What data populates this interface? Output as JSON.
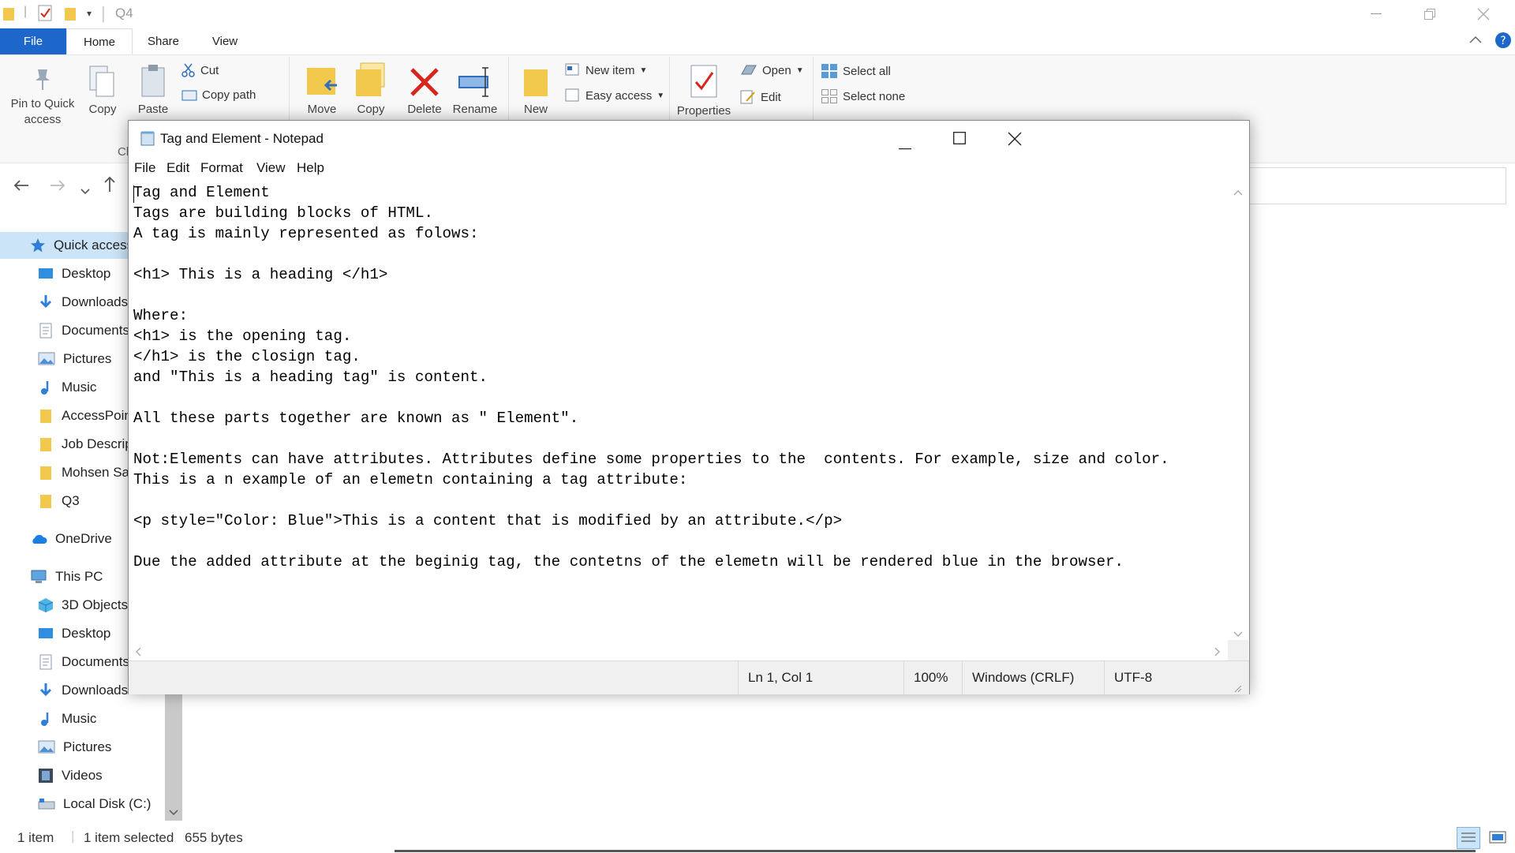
{
  "explorer": {
    "title": "Q4",
    "qat_dropdown": "▾",
    "tabs": [
      "File",
      "Home",
      "Share",
      "View"
    ],
    "ribbon": {
      "pin_to_quick_access": "Pin to Quick access",
      "copy": "Copy",
      "paste": "Paste",
      "cut": "Cut",
      "copy_path": "Copy path",
      "clipboard_partial": "Cl",
      "move": "Move",
      "copy_to": "Copy",
      "delete": "Delete",
      "rename": "Rename",
      "new": "New",
      "new_item": "New item",
      "easy_access": "Easy access",
      "properties": "Properties",
      "open": "Open",
      "edit": "Edit",
      "select_all": "Select all",
      "select_none": "Select none"
    },
    "sidebar": {
      "quick_access": "Quick access",
      "quick_items": [
        "Desktop",
        "Downloads",
        "Documents",
        "Pictures",
        "Music",
        "AccessPoint",
        "Job Description",
        "Mohsen Sa",
        "Q3"
      ],
      "onedrive": "OneDrive",
      "this_pc": "This PC",
      "pc_items": [
        "3D Objects",
        "Desktop",
        "Documents",
        "Downloads",
        "Music",
        "Pictures",
        "Videos",
        "Local Disk (C:)"
      ]
    },
    "status": {
      "count": "1 item",
      "selected": "1 item selected",
      "size": "655 bytes"
    },
    "colors": {
      "accent": "#1c67c9",
      "folder": "#f2c94c",
      "delete_red": "#d7261e"
    }
  },
  "notepad": {
    "title": "Tag and Element - Notepad",
    "menu": [
      "File",
      "Edit",
      "Format",
      "View",
      "Help"
    ],
    "lines": [
      "Tag and Element",
      "Tags are building blocks of HTML.",
      "A tag is mainly represented as folows:",
      "",
      "<h1> This is a heading </h1>",
      "",
      "Where:",
      "<h1> is the opening tag.",
      "</h1> is the closign tag.",
      "and \"This is a heading tag\" is content.",
      "",
      "All these parts together are known as \" Element\".",
      "",
      "Not:Elements can have attributes. Attributes define some properties to the  contents. For example, size and color.",
      "This is a n example of an elemetn containing a tag attribute:",
      "",
      "<p style=\"Color: Blue\">This is a content that is modified by an attribute.</p>",
      "",
      "Due the added attribute at the beginig tag, the contetns of the elemetn will be rendered blue in the browser."
    ],
    "status": {
      "position": "Ln 1, Col 1",
      "zoom": "100%",
      "line_ending": "Windows (CRLF)",
      "encoding": "UTF-8"
    }
  }
}
